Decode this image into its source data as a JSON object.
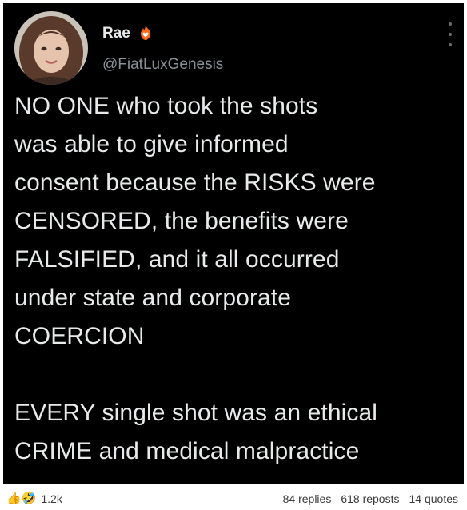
{
  "post": {
    "author_name": "Rae",
    "author_handle": "@FiatLuxGenesis",
    "name_badge_icon": "fire-heart-icon",
    "body": "NO ONE who took the shots\nwas able to give informed\nconsent because the RISKS were\nCENSORED, the benefits were\nFALSIFIED, and it all occurred\nunder state and corporate\nCOERCION\n\nEVERY single shot was an ethical\nCRIME and medical malpractice"
  },
  "footer": {
    "reaction_icons": [
      "thumbs-up-icon",
      "laughing-emoji-icon"
    ],
    "reaction_count": "1.2k",
    "replies": "84 replies",
    "reposts": "618 reposts",
    "quotes": "14 quotes"
  },
  "colors": {
    "tweet_background": "#000000",
    "text": "#e7e9ea",
    "handle": "#8b9096",
    "footer_text": "#3a3a3a"
  }
}
